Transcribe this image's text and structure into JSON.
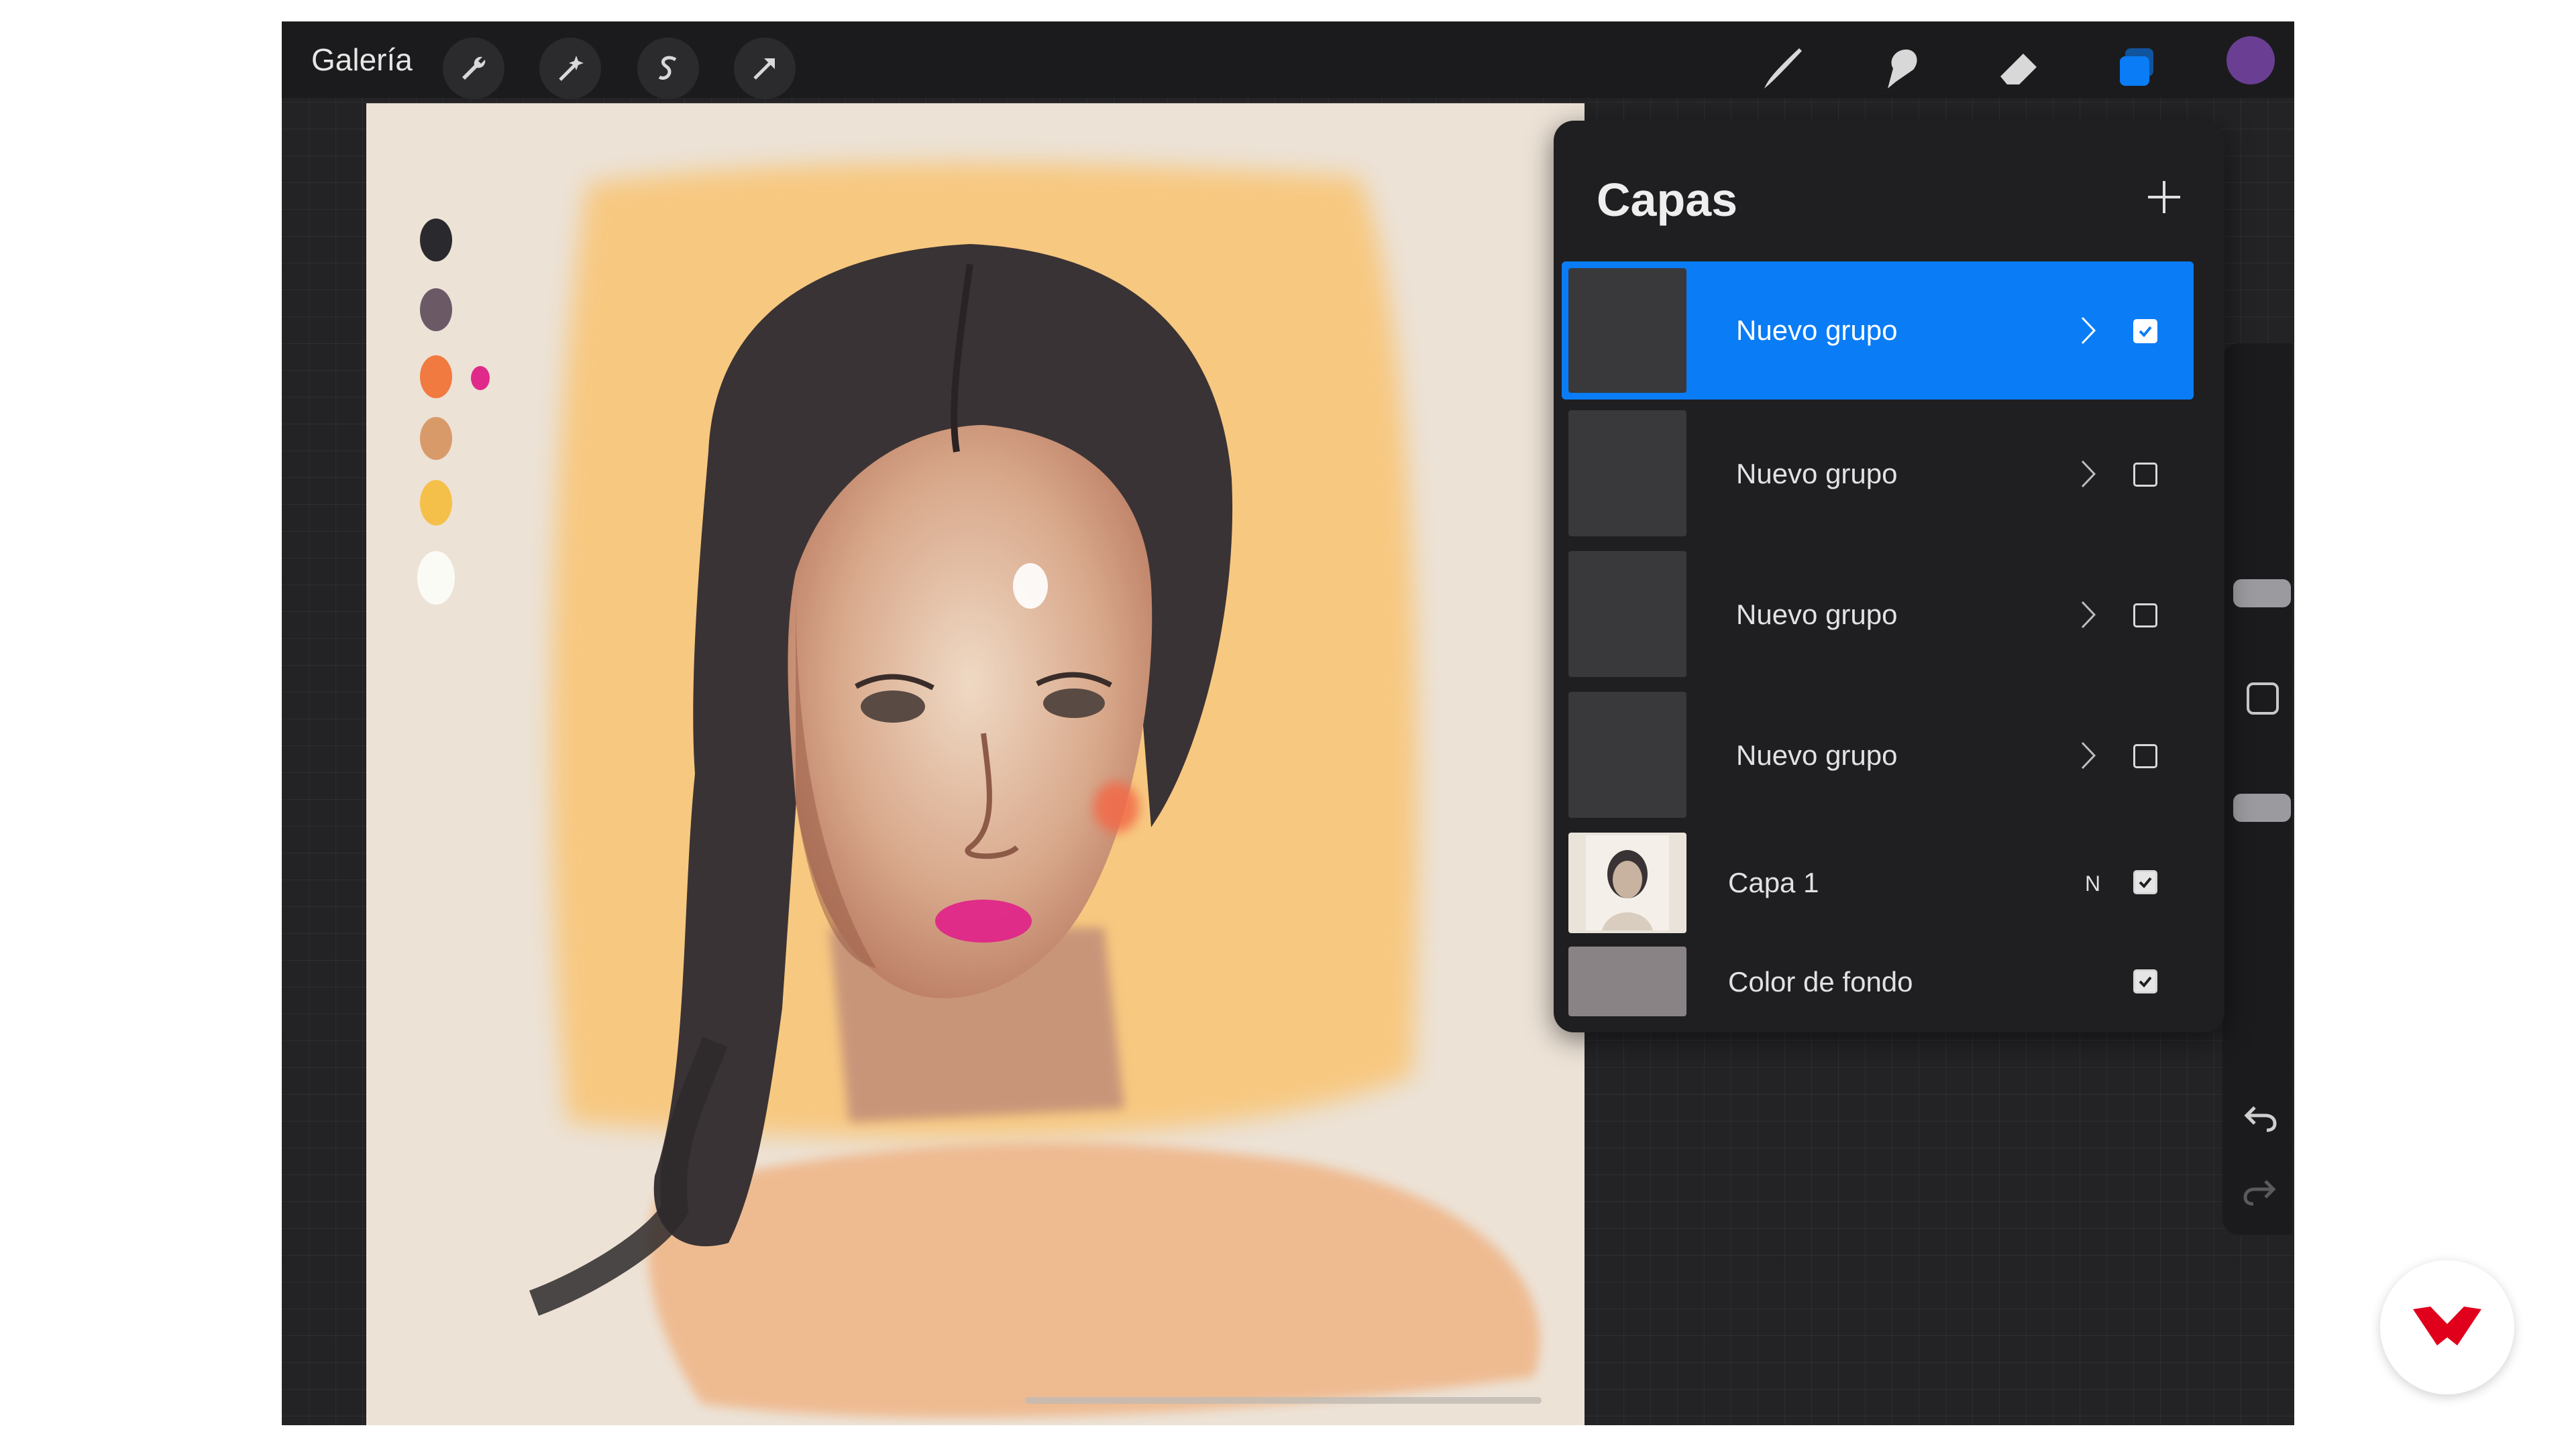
{
  "toolbar": {
    "gallery_label": "Galería",
    "left_tools": [
      "wrench-icon",
      "magic-wand-icon",
      "selection-icon",
      "transform-arrow-icon"
    ],
    "right_tools": [
      "brush-icon",
      "smudge-icon",
      "eraser-icon",
      "layers-icon"
    ],
    "current_color": "#6a3e92"
  },
  "layers_panel": {
    "title": "Capas",
    "add_icon": "plus-icon",
    "layers": [
      {
        "name": "Nuevo grupo",
        "type": "group",
        "visible": true,
        "selected": true
      },
      {
        "name": "Nuevo grupo",
        "type": "group",
        "visible": false,
        "selected": false
      },
      {
        "name": "Nuevo grupo",
        "type": "group",
        "visible": false,
        "selected": false
      },
      {
        "name": "Nuevo grupo",
        "type": "group",
        "visible": false,
        "selected": false
      },
      {
        "name": "Capa 1",
        "type": "layer",
        "blend": "N",
        "visible": true,
        "selected": false
      },
      {
        "name": "Color de fondo",
        "type": "background",
        "visible": true,
        "selected": false,
        "color": "#8a8385"
      }
    ]
  },
  "palette_swatches": [
    "#2a2a2e",
    "#6b5a66",
    "#f07a40",
    "#d99a6a",
    "#f5c04a",
    "#fbfbf6"
  ],
  "colors": {
    "accent": "#0a7cf5",
    "panel_bg": "#1f1f22",
    "brand": "#e0001b"
  }
}
